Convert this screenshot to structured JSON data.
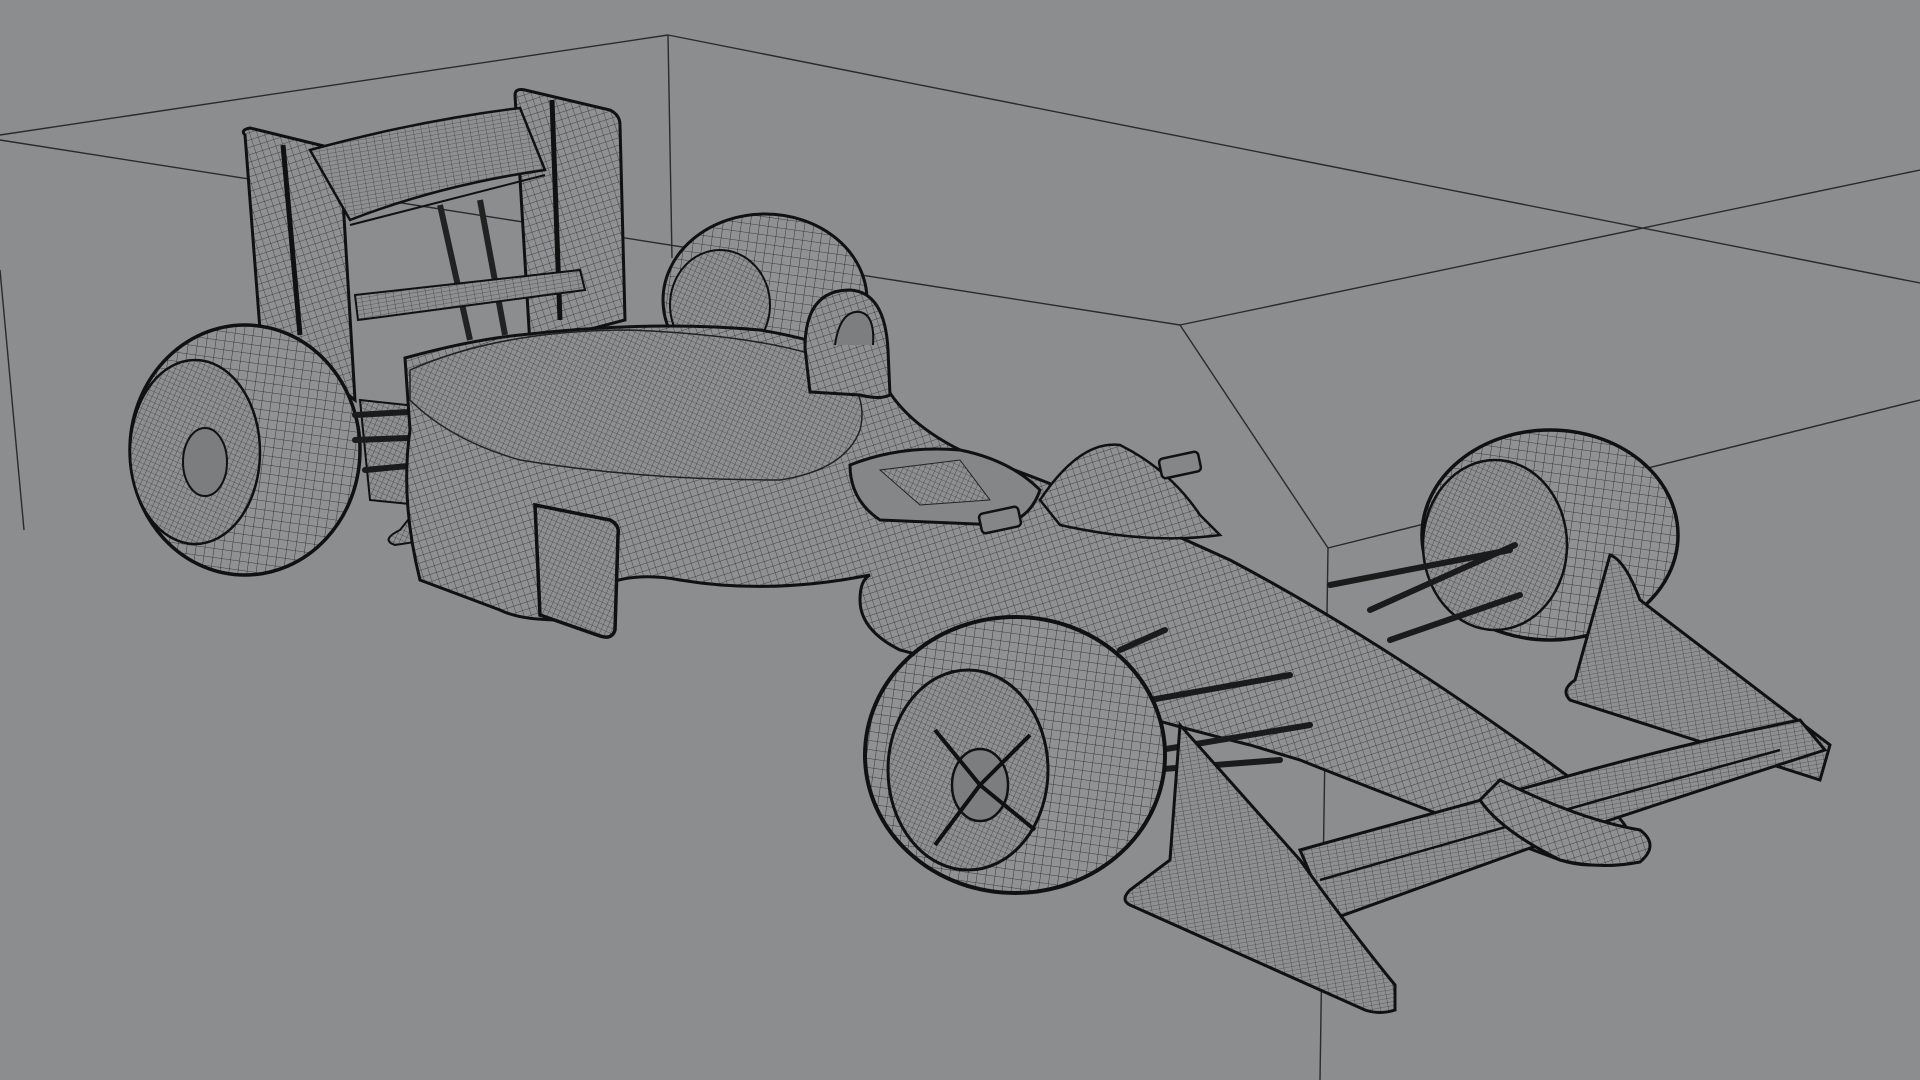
{
  "viewport": {
    "background_color": "#8c8d8f",
    "mode": "wireframe-on-shaded"
  },
  "model": {
    "subject": "formula-1-race-car",
    "parts": [
      "rear-wing",
      "rear-left-tire",
      "rear-right-tire",
      "engine-cover",
      "sidepod",
      "roll-hoop",
      "cockpit",
      "nose-cone",
      "front-wing",
      "front-left-tire",
      "front-right-tire",
      "suspension-arms",
      "mirrors"
    ],
    "shading": {
      "surface_color": "#8f9092",
      "wire_color": "#1a1a1a"
    }
  },
  "bounding_box": {
    "color": "#2a2a2a"
  }
}
